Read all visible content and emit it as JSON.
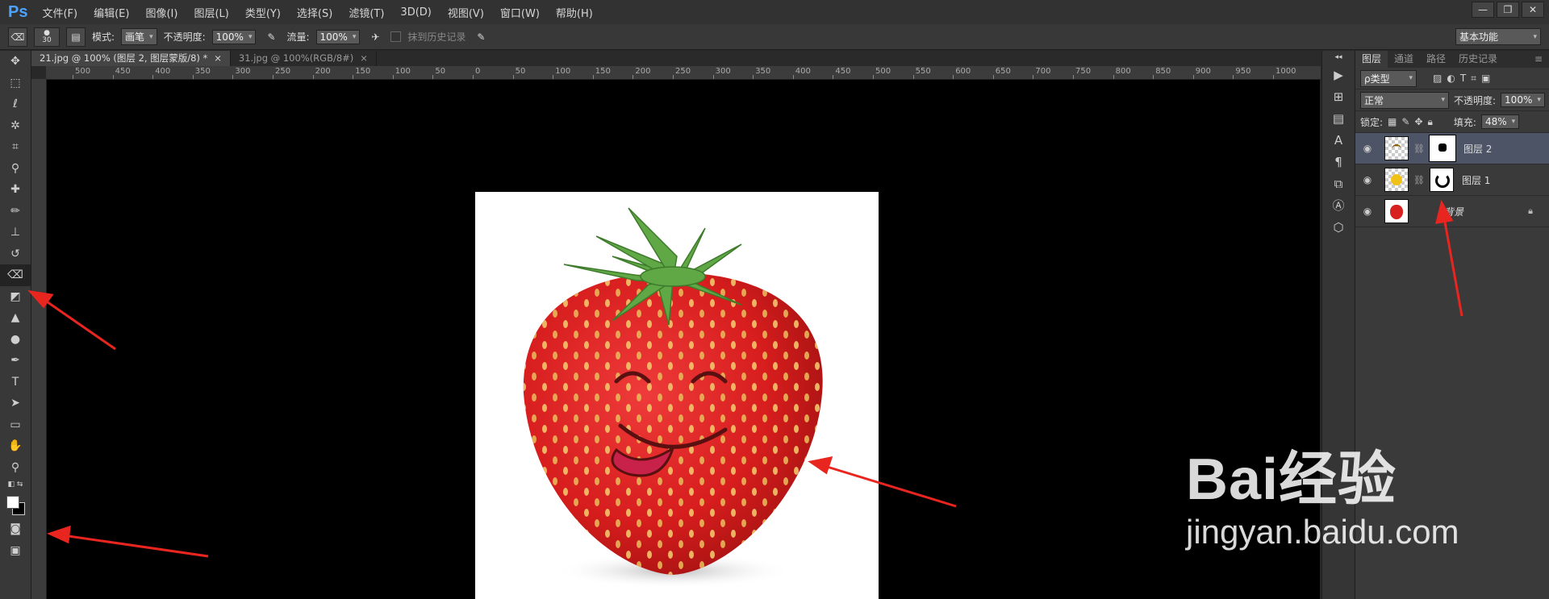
{
  "app": {
    "logo": "Ps"
  },
  "menu": [
    "文件(F)",
    "编辑(E)",
    "图像(I)",
    "图层(L)",
    "类型(Y)",
    "选择(S)",
    "滤镜(T)",
    "3D(D)",
    "视图(V)",
    "窗口(W)",
    "帮助(H)"
  ],
  "window_controls": {
    "minimize": "—",
    "restore": "❐",
    "close": "✕"
  },
  "options": {
    "brush_size": "30",
    "mode_label": "模式:",
    "mode_value": "画笔",
    "opacity_label": "不透明度:",
    "opacity_value": "100%",
    "flow_label": "流量:",
    "flow_value": "100%",
    "erase_history_label": "抹到历史记录",
    "workspace": "基本功能"
  },
  "tabs": [
    {
      "title": "21.jpg @ 100% (图层 2, 图层蒙版/8) *",
      "close": "×"
    },
    {
      "title": "31.jpg @ 100%(RGB/8#)",
      "close": "×"
    }
  ],
  "ruler_labels": [
    "500",
    "450",
    "400",
    "350",
    "300",
    "250",
    "200",
    "150",
    "100",
    "50",
    "0",
    "50",
    "100",
    "150",
    "200",
    "250",
    "300",
    "350",
    "400",
    "450",
    "500",
    "550",
    "600",
    "650",
    "700",
    "750",
    "800",
    "850",
    "900",
    "950",
    "1000"
  ],
  "panel": {
    "tabs": [
      "图层",
      "通道",
      "路径",
      "历史记录"
    ],
    "filter_kind": "ρ类型",
    "blend_mode": "正常",
    "opacity_label": "不透明度:",
    "opacity_value": "100%",
    "lock_label": "锁定:",
    "fill_label": "填充:",
    "fill_value": "48%",
    "layers": [
      {
        "name": "图层 2"
      },
      {
        "name": "图层 1"
      },
      {
        "name": "背景"
      }
    ]
  },
  "watermark": {
    "brand": "Bai经验",
    "url": "jingyan.baidu.com"
  }
}
